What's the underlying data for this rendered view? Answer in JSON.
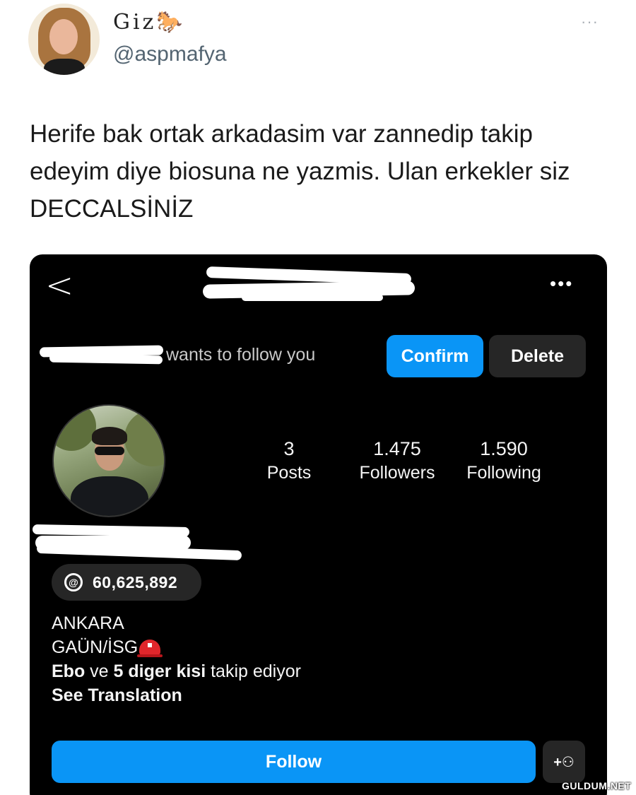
{
  "tweet": {
    "display_name": "Giz",
    "name_badge": "🐎",
    "handle": "@aspmafya",
    "more_icon": "···",
    "text": "Herife bak ortak arkadasim var zannedip takip edeyim diye biosuna ne yazmis. Ulan erkekler siz DECCALSİNİZ"
  },
  "instagram": {
    "back_icon": "<",
    "more_icon": "•••",
    "follow_request": {
      "text": "wants to follow you",
      "confirm_label": "Confirm",
      "delete_label": "Delete"
    },
    "stats": {
      "posts": {
        "value": "3",
        "label": "Posts"
      },
      "followers": {
        "value": "1.475",
        "label": "Followers"
      },
      "following": {
        "value": "1.590",
        "label": "Following"
      }
    },
    "threads": {
      "icon": "@",
      "count": "60,625,892"
    },
    "bio": {
      "line1": "ANKARA",
      "line2": "GAÜN/İSG",
      "followed_by_name": "Ebo",
      "followed_by_mid": "ve",
      "followed_by_others": "5 diger kisi",
      "followed_by_tail": "takip ediyor",
      "see_translation": "See Translation"
    },
    "follow_label": "Follow",
    "suggest_icon": "+⚇"
  },
  "watermark": "GULDUM.NET"
}
